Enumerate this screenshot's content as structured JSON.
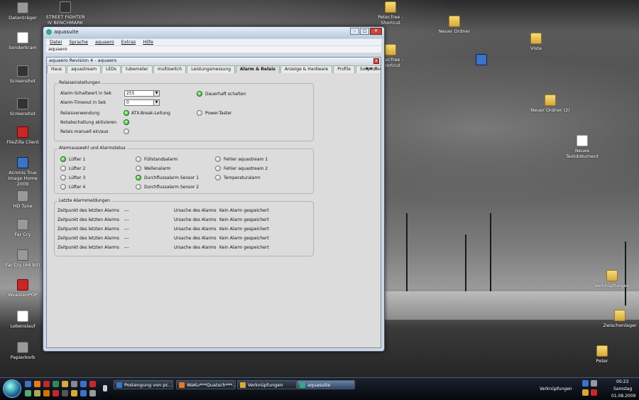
{
  "desktop": {
    "icons_left": [
      {
        "label": "Datenträger",
        "icon": "drive-icon",
        "kind": "gray"
      },
      {
        "label": "Sonderkram",
        "icon": "document-icon",
        "kind": "doc"
      },
      {
        "label": "Screenshot",
        "icon": "screenshot-icon",
        "kind": "dark"
      },
      {
        "label": "Screenshot",
        "icon": "screenshot-icon",
        "kind": "dark"
      },
      {
        "label": "FileZilla Client",
        "icon": "filezilla-icon",
        "kind": "red"
      },
      {
        "label": "Acronis True Image Home 2009",
        "icon": "acronis-icon",
        "kind": "blue"
      },
      {
        "label": "HD Tune",
        "icon": "hdtune-icon",
        "kind": "gray"
      },
      {
        "label": "Far Cry",
        "icon": "farcry-icon",
        "kind": "gray"
      },
      {
        "label": "Far Cry (64 bit)",
        "icon": "farcry-icon",
        "kind": "gray"
      },
      {
        "label": "WuestenPOP",
        "icon": "app-icon",
        "kind": "red"
      },
      {
        "label": "Lebenslauf",
        "icon": "document-icon",
        "kind": "doc"
      },
      {
        "label": "Papierkorb",
        "icon": "recycle-bin-icon",
        "kind": "gray"
      }
    ],
    "icons_other": [
      {
        "label": "STREET FIGHTER IV BENCHMARK",
        "icon": "game-icon",
        "kind": "dark"
      },
      {
        "label": "Peter.free - Shortcut",
        "icon": "folder-icon",
        "kind": "folder"
      },
      {
        "label": "Neuer Ordner",
        "icon": "folder-icon",
        "kind": "folder"
      },
      {
        "label": "Vista",
        "icon": "folder-icon",
        "kind": "folder"
      },
      {
        "label": "Peter.free - Shortcut",
        "icon": "folder-icon",
        "kind": "folder"
      },
      {
        "label": "",
        "icon": "network-icon",
        "kind": "blue"
      },
      {
        "label": "Neuer Ordner (2)",
        "icon": "folder-icon",
        "kind": "folder"
      },
      {
        "label": "Neues Textdokument",
        "icon": "document-icon",
        "kind": "doc"
      },
      {
        "label": "Verknüpfungen",
        "icon": "folder-icon",
        "kind": "folder"
      },
      {
        "label": "Zwischenlager",
        "icon": "folder-icon",
        "kind": "folder"
      },
      {
        "label": "Peter",
        "icon": "user-folder-icon",
        "kind": "folder"
      }
    ]
  },
  "window": {
    "title": "aquasuite",
    "menu": [
      "Datei",
      "Sprache",
      "aquaero",
      "Extras",
      "Hilfe"
    ],
    "subbar": "aquaero",
    "inner_title": "aquaero Revision 4 - aquaero",
    "tabs": [
      "Haus",
      "aquastream",
      "LEDs",
      "tubemeter",
      "multiswitch",
      "Leistungsmessung",
      "Alarm & Relais",
      "Anzeige & Hardware",
      "Profile",
      "Sollpitsteuerung",
      "Sl"
    ],
    "active_tab": "Alarm & Relais",
    "relay": {
      "legend": "Relaiseinstellungen",
      "rows": [
        {
          "label": "Alarm-Schaltwert in Sek",
          "value": "255"
        },
        {
          "label": "Alarm-Timeout in Sek",
          "value": "0"
        }
      ],
      "checks": [
        {
          "label": "Relaisverwendung",
          "led": "",
          "on": false
        },
        {
          "label": "ATX-Break-Leitung",
          "led": "",
          "on": true
        },
        {
          "label": "Notabschaltung aktivieren",
          "led": "",
          "on": true
        },
        {
          "label": "Relais manuell ein/aus",
          "led": "",
          "on": false
        }
      ],
      "right": [
        {
          "label": "Dauerhaft schalten",
          "on": true
        },
        {
          "label": "Power-Taster",
          "on": false
        }
      ]
    },
    "alarms": {
      "legend": "Alarmauswahl und Alarmstatus",
      "col1": [
        {
          "label": "Lüfter 1",
          "on": true
        },
        {
          "label": "Lüfter 2",
          "on": false
        },
        {
          "label": "Lüfter 3",
          "on": false
        },
        {
          "label": "Lüfter 4",
          "on": false
        }
      ],
      "col2": [
        {
          "label": "Füllstandsalarm",
          "on": false
        },
        {
          "label": "Wellenalarm",
          "on": false
        },
        {
          "label": "Durchflussalarm Sensor 1",
          "on": true
        },
        {
          "label": "Durchflussalarm Sensor 2",
          "on": false
        }
      ],
      "col3": [
        {
          "label": "Fehler aquastream 1",
          "on": false
        },
        {
          "label": "Fehler aquastream 2",
          "on": false
        },
        {
          "label": "Temperaturalarm",
          "on": false
        }
      ]
    },
    "messages": {
      "legend": "Letzte Alarmmeldungen",
      "rows": [
        {
          "time_label": "Zeitpunkt des letzten Alarms",
          "time": "---",
          "cause_label": "Ursache des Alarms",
          "cause": "Kein Alarm gespeichert"
        },
        {
          "time_label": "Zeitpunkt des letzten Alarms",
          "time": "---",
          "cause_label": "Ursache des Alarms",
          "cause": "Kein Alarm gespeichert"
        },
        {
          "time_label": "Zeitpunkt des letzten Alarms",
          "time": "---",
          "cause_label": "Ursache des Alarms",
          "cause": "Kein Alarm gespeichert"
        },
        {
          "time_label": "Zeitpunkt des letzten Alarms",
          "time": "---",
          "cause_label": "Ursache des Alarms",
          "cause": "Kein Alarm gespeichert"
        },
        {
          "time_label": "Zeitpunkt des letzten Alarms",
          "time": "---",
          "cause_label": "Ursache des Alarms",
          "cause": "Kein Alarm gespeichert"
        }
      ]
    }
  },
  "taskbar": {
    "items": [
      {
        "label": "Postengung von pc...",
        "icon": "ie-icon",
        "active": false
      },
      {
        "label": "WaKu***Quatsch***...",
        "icon": "firefox-icon",
        "active": false
      },
      {
        "label": "Verknüpfungen",
        "icon": "folder-icon",
        "active": false
      },
      {
        "label": "aquasuite",
        "icon": "aquasuite-icon",
        "active": true
      }
    ],
    "tray_label": "Verknüpfungen",
    "time": "00:23",
    "day": "Samstag",
    "date": "01.08.2009"
  }
}
